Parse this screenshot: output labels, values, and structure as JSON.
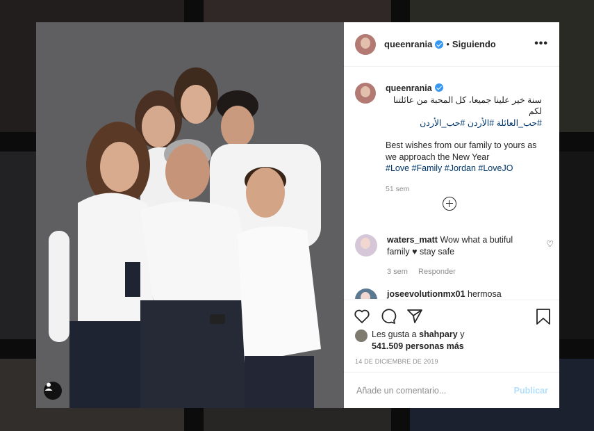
{
  "post": {
    "username": "queenrania",
    "dot": "•",
    "follow_status": "Siguiendo",
    "more_icon": "•••"
  },
  "caption": {
    "username": "queenrania",
    "arabic_line1": "سنة خير علينا جميعا، كل المحبة من عائلتنا لكم",
    "arabic_hashtags": "#حب_العائلة #الأردن #حب_الأردن",
    "english": "Best wishes from our family to yours as we approach the New Year",
    "hashtags": "#Love #Family #Jordan #LoveJO",
    "time": "51 sem"
  },
  "comments": [
    {
      "username": "waters_matt",
      "text": "Wow what a butiful family ♥ stay safe",
      "time": "3 sem",
      "reply": "Responder"
    },
    {
      "username": "joseevolutionmx01",
      "text": "hermosa"
    }
  ],
  "likes": {
    "prefix": "Les gusta a",
    "user": "shahpary",
    "conj": "y",
    "count": "541.509 personas más"
  },
  "date": "14 DE DICIEMBRE DE 2019",
  "add_comment": {
    "placeholder": "Añade un comentario...",
    "publish": "Publicar"
  },
  "icons": {
    "like": "heart-icon",
    "comment": "comment-icon",
    "share": "share-icon",
    "save": "bookmark-icon",
    "tag": "user-tag-icon",
    "load_more": "plus-circle-icon"
  }
}
